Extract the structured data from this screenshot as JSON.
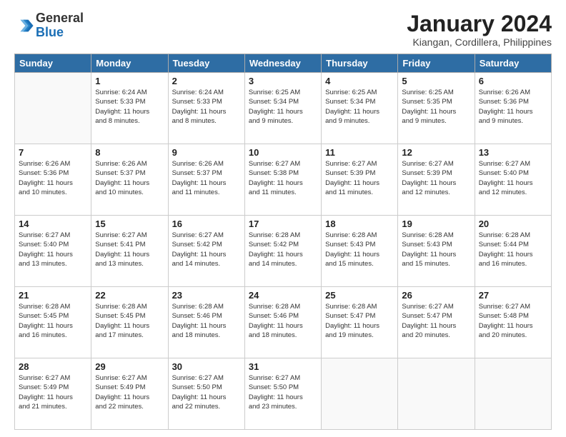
{
  "header": {
    "logo_general": "General",
    "logo_blue": "Blue",
    "month_title": "January 2024",
    "subtitle": "Kiangan, Cordillera, Philippines"
  },
  "days_of_week": [
    "Sunday",
    "Monday",
    "Tuesday",
    "Wednesday",
    "Thursday",
    "Friday",
    "Saturday"
  ],
  "weeks": [
    [
      {
        "day": "",
        "info": ""
      },
      {
        "day": "1",
        "info": "Sunrise: 6:24 AM\nSunset: 5:33 PM\nDaylight: 11 hours\nand 8 minutes."
      },
      {
        "day": "2",
        "info": "Sunrise: 6:24 AM\nSunset: 5:33 PM\nDaylight: 11 hours\nand 8 minutes."
      },
      {
        "day": "3",
        "info": "Sunrise: 6:25 AM\nSunset: 5:34 PM\nDaylight: 11 hours\nand 9 minutes."
      },
      {
        "day": "4",
        "info": "Sunrise: 6:25 AM\nSunset: 5:34 PM\nDaylight: 11 hours\nand 9 minutes."
      },
      {
        "day": "5",
        "info": "Sunrise: 6:25 AM\nSunset: 5:35 PM\nDaylight: 11 hours\nand 9 minutes."
      },
      {
        "day": "6",
        "info": "Sunrise: 6:26 AM\nSunset: 5:36 PM\nDaylight: 11 hours\nand 9 minutes."
      }
    ],
    [
      {
        "day": "7",
        "info": "Sunrise: 6:26 AM\nSunset: 5:36 PM\nDaylight: 11 hours\nand 10 minutes."
      },
      {
        "day": "8",
        "info": "Sunrise: 6:26 AM\nSunset: 5:37 PM\nDaylight: 11 hours\nand 10 minutes."
      },
      {
        "day": "9",
        "info": "Sunrise: 6:26 AM\nSunset: 5:37 PM\nDaylight: 11 hours\nand 11 minutes."
      },
      {
        "day": "10",
        "info": "Sunrise: 6:27 AM\nSunset: 5:38 PM\nDaylight: 11 hours\nand 11 minutes."
      },
      {
        "day": "11",
        "info": "Sunrise: 6:27 AM\nSunset: 5:39 PM\nDaylight: 11 hours\nand 11 minutes."
      },
      {
        "day": "12",
        "info": "Sunrise: 6:27 AM\nSunset: 5:39 PM\nDaylight: 11 hours\nand 12 minutes."
      },
      {
        "day": "13",
        "info": "Sunrise: 6:27 AM\nSunset: 5:40 PM\nDaylight: 11 hours\nand 12 minutes."
      }
    ],
    [
      {
        "day": "14",
        "info": "Sunrise: 6:27 AM\nSunset: 5:40 PM\nDaylight: 11 hours\nand 13 minutes."
      },
      {
        "day": "15",
        "info": "Sunrise: 6:27 AM\nSunset: 5:41 PM\nDaylight: 11 hours\nand 13 minutes."
      },
      {
        "day": "16",
        "info": "Sunrise: 6:27 AM\nSunset: 5:42 PM\nDaylight: 11 hours\nand 14 minutes."
      },
      {
        "day": "17",
        "info": "Sunrise: 6:28 AM\nSunset: 5:42 PM\nDaylight: 11 hours\nand 14 minutes."
      },
      {
        "day": "18",
        "info": "Sunrise: 6:28 AM\nSunset: 5:43 PM\nDaylight: 11 hours\nand 15 minutes."
      },
      {
        "day": "19",
        "info": "Sunrise: 6:28 AM\nSunset: 5:43 PM\nDaylight: 11 hours\nand 15 minutes."
      },
      {
        "day": "20",
        "info": "Sunrise: 6:28 AM\nSunset: 5:44 PM\nDaylight: 11 hours\nand 16 minutes."
      }
    ],
    [
      {
        "day": "21",
        "info": "Sunrise: 6:28 AM\nSunset: 5:45 PM\nDaylight: 11 hours\nand 16 minutes."
      },
      {
        "day": "22",
        "info": "Sunrise: 6:28 AM\nSunset: 5:45 PM\nDaylight: 11 hours\nand 17 minutes."
      },
      {
        "day": "23",
        "info": "Sunrise: 6:28 AM\nSunset: 5:46 PM\nDaylight: 11 hours\nand 18 minutes."
      },
      {
        "day": "24",
        "info": "Sunrise: 6:28 AM\nSunset: 5:46 PM\nDaylight: 11 hours\nand 18 minutes."
      },
      {
        "day": "25",
        "info": "Sunrise: 6:28 AM\nSunset: 5:47 PM\nDaylight: 11 hours\nand 19 minutes."
      },
      {
        "day": "26",
        "info": "Sunrise: 6:27 AM\nSunset: 5:47 PM\nDaylight: 11 hours\nand 20 minutes."
      },
      {
        "day": "27",
        "info": "Sunrise: 6:27 AM\nSunset: 5:48 PM\nDaylight: 11 hours\nand 20 minutes."
      }
    ],
    [
      {
        "day": "28",
        "info": "Sunrise: 6:27 AM\nSunset: 5:49 PM\nDaylight: 11 hours\nand 21 minutes."
      },
      {
        "day": "29",
        "info": "Sunrise: 6:27 AM\nSunset: 5:49 PM\nDaylight: 11 hours\nand 22 minutes."
      },
      {
        "day": "30",
        "info": "Sunrise: 6:27 AM\nSunset: 5:50 PM\nDaylight: 11 hours\nand 22 minutes."
      },
      {
        "day": "31",
        "info": "Sunrise: 6:27 AM\nSunset: 5:50 PM\nDaylight: 11 hours\nand 23 minutes."
      },
      {
        "day": "",
        "info": ""
      },
      {
        "day": "",
        "info": ""
      },
      {
        "day": "",
        "info": ""
      }
    ]
  ]
}
